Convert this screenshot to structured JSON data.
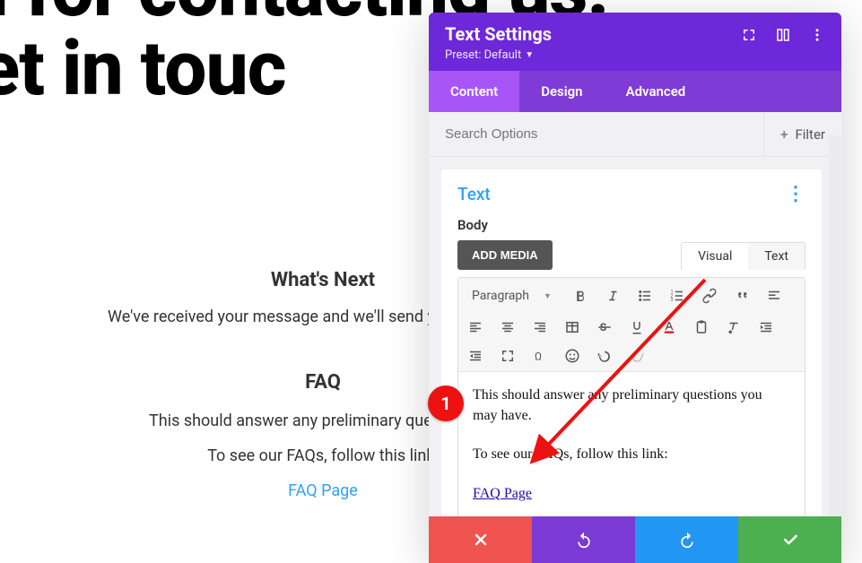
{
  "background": {
    "headline_line1": "k you for contacting us.",
    "headline_line2": "e'll get in touc",
    "whats_next_heading": "What's Next",
    "whats_next_text": "We've received your message and we'll send you an email wi",
    "faq_heading": "FAQ",
    "faq_line1": "This should answer any preliminary questions yo",
    "faq_line2": "To see our FAQs, follow this link:",
    "faq_link_label": "FAQ Page"
  },
  "panel": {
    "title": "Text Settings",
    "preset_label": "Preset: Default",
    "tabs": {
      "content": "Content",
      "design": "Design",
      "advanced": "Advanced",
      "active": "content"
    },
    "search_placeholder": "Search Options",
    "filter_label": "Filter",
    "section_title": "Text",
    "body_label": "Body",
    "add_media_label": "ADD MEDIA",
    "editor_tabs": {
      "visual": "Visual",
      "text": "Text",
      "active": "visual"
    },
    "paragraph_select": "Paragraph",
    "editor": {
      "p1": "This should answer any preliminary questions you may have.",
      "p2": "To see our FAQs, follow this link:",
      "link_text": "FAQ Page"
    }
  },
  "annotation": {
    "marker_number": "1"
  }
}
